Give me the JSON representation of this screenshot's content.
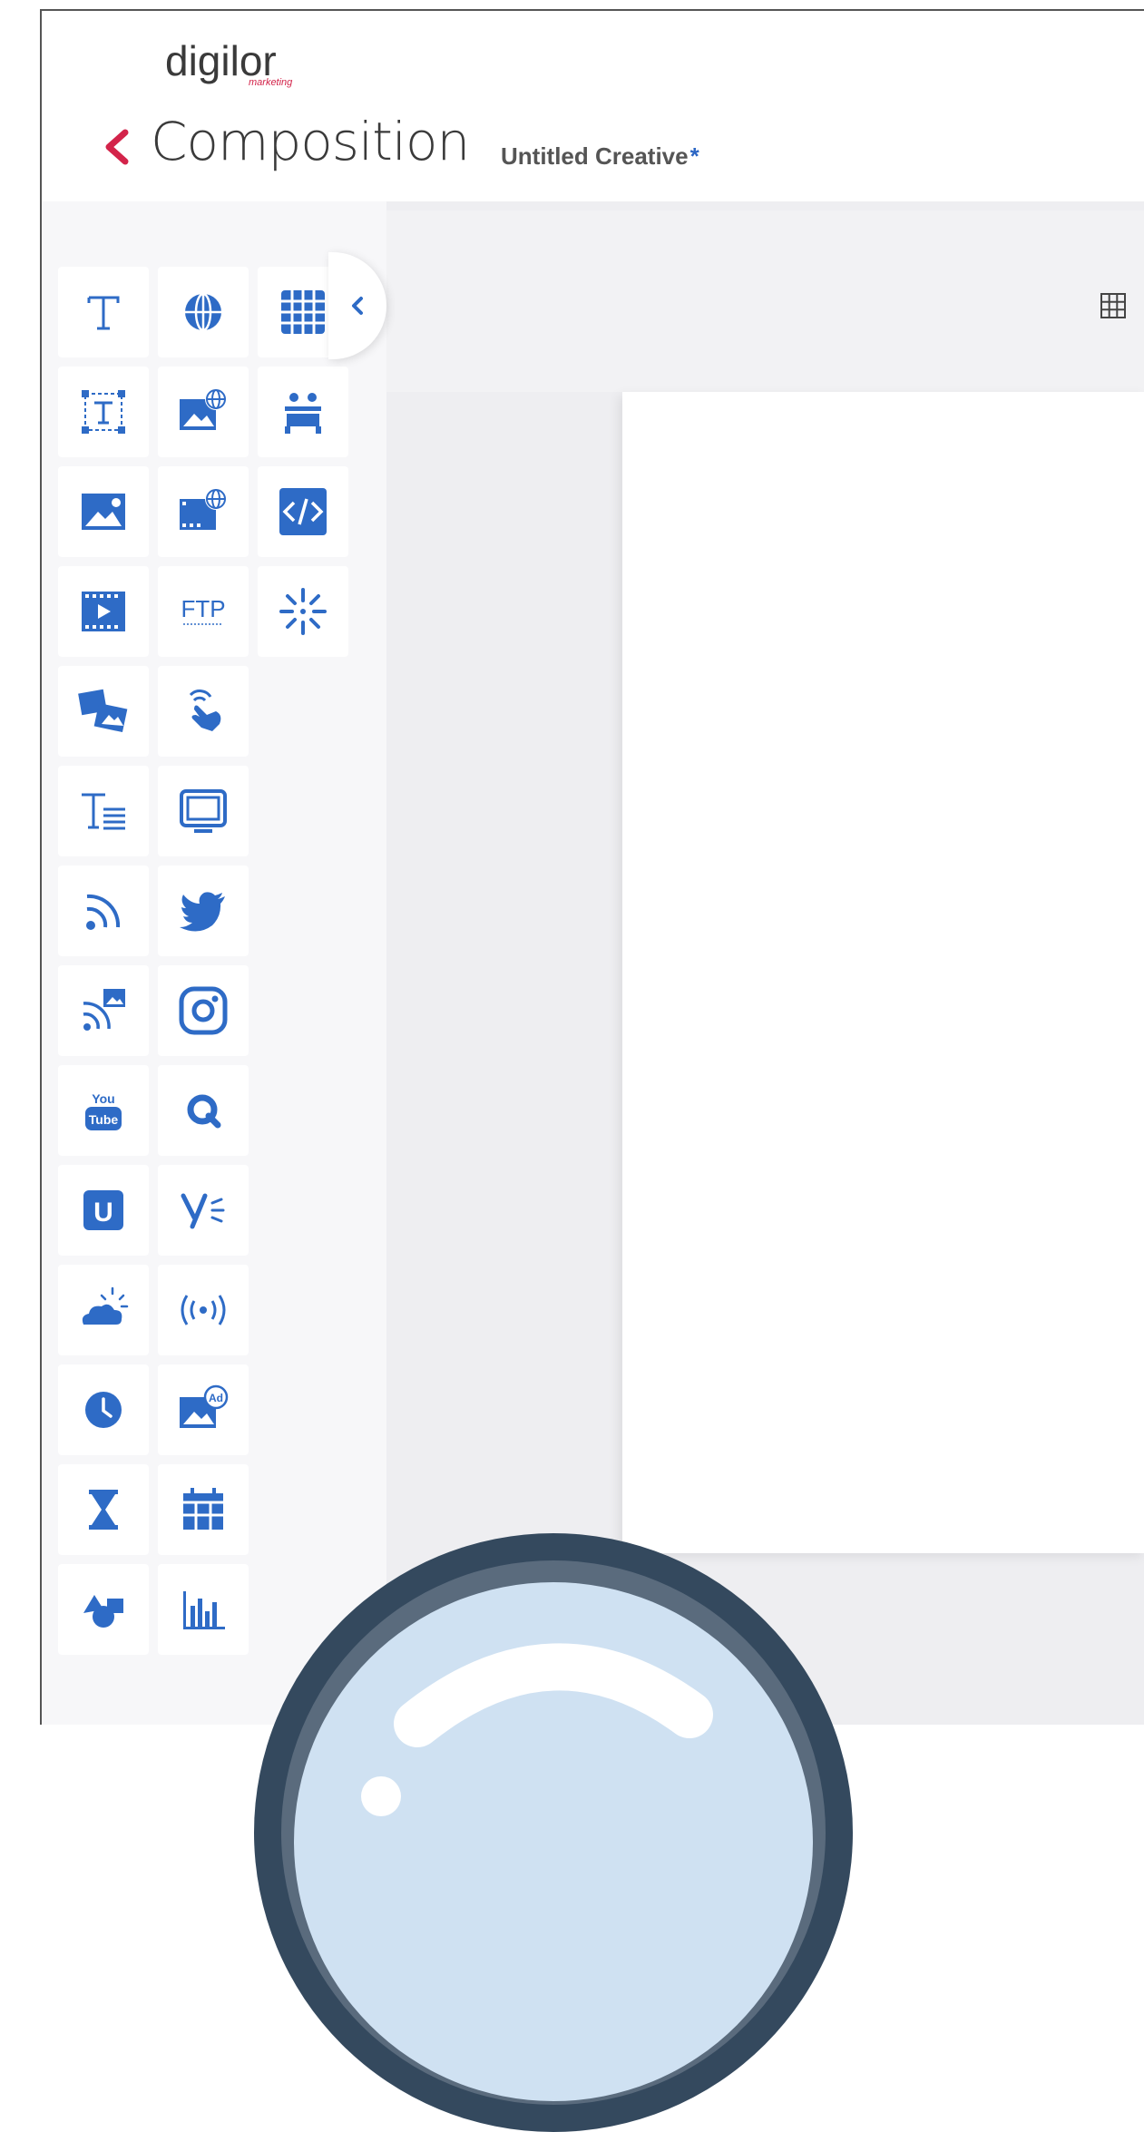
{
  "header": {
    "logo_text": "digilor",
    "logo_sub": "marketing",
    "title": "Composition",
    "document_name": "Untitled Creative",
    "unsaved_marker": "*"
  },
  "colors": {
    "accent_blue": "#2e6bc6",
    "brand_red": "#d3244a",
    "text_dark": "#3a3a3a"
  },
  "sidebar": {
    "widgets": [
      {
        "name": "text",
        "icon": "text-icon"
      },
      {
        "name": "web",
        "icon": "globe-icon"
      },
      {
        "name": "table",
        "icon": "table-icon"
      },
      {
        "name": "text-frame",
        "icon": "text-frame-icon"
      },
      {
        "name": "web-image",
        "icon": "web-image-icon"
      },
      {
        "name": "people-counter",
        "icon": "people-icon"
      },
      {
        "name": "image",
        "icon": "image-icon"
      },
      {
        "name": "web-video",
        "icon": "web-video-icon"
      },
      {
        "name": "html",
        "icon": "code-icon"
      },
      {
        "name": "video",
        "icon": "video-icon"
      },
      {
        "name": "ftp",
        "icon": "ftp-icon",
        "label": "FTP"
      },
      {
        "name": "loading",
        "icon": "spinner-icon"
      },
      {
        "name": "slideshow",
        "icon": "slideshow-icon"
      },
      {
        "name": "touch",
        "icon": "touch-icon"
      },
      {
        "name": "ticker",
        "icon": "text-ticker-icon"
      },
      {
        "name": "screen",
        "icon": "screen-icon"
      },
      {
        "name": "rss",
        "icon": "rss-icon"
      },
      {
        "name": "twitter",
        "icon": "twitter-icon"
      },
      {
        "name": "rss-image",
        "icon": "rss-image-icon"
      },
      {
        "name": "instagram",
        "icon": "instagram-icon"
      },
      {
        "name": "youtube",
        "icon": "youtube-icon",
        "label": "You Tube"
      },
      {
        "name": "queue",
        "icon": "queue-icon"
      },
      {
        "name": "u-widget",
        "icon": "u-icon",
        "label": "U"
      },
      {
        "name": "yammer",
        "icon": "yammer-icon"
      },
      {
        "name": "weather",
        "icon": "weather-icon"
      },
      {
        "name": "broadcast",
        "icon": "broadcast-icon"
      },
      {
        "name": "clock",
        "icon": "clock-icon"
      },
      {
        "name": "ad",
        "icon": "ad-image-icon",
        "label": "Ad"
      },
      {
        "name": "countdown",
        "icon": "hourglass-icon"
      },
      {
        "name": "calendar",
        "icon": "calendar-icon"
      },
      {
        "name": "shapes",
        "icon": "shapes-icon"
      },
      {
        "name": "chart",
        "icon": "chart-icon"
      }
    ]
  }
}
